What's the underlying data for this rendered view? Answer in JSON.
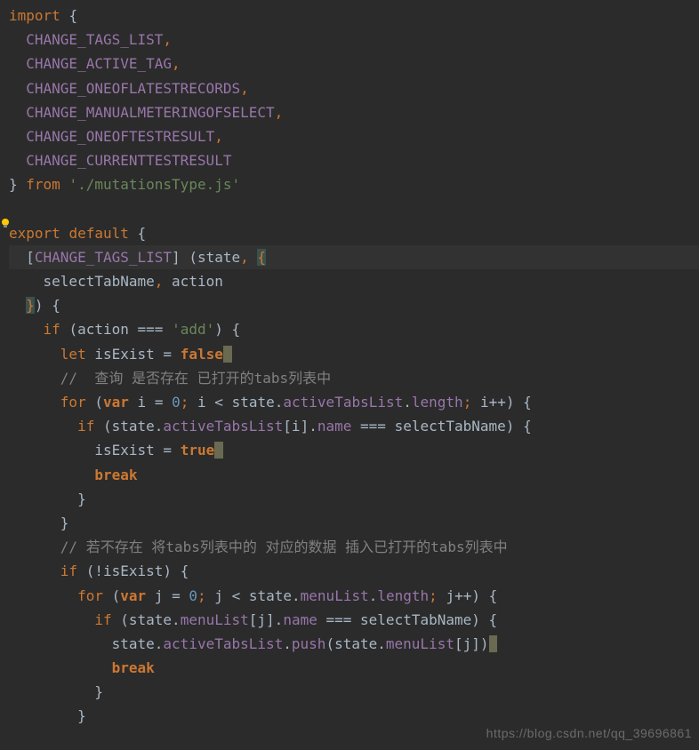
{
  "code": {
    "line1_import": "import",
    "line1_brace": "{",
    "line2": "CHANGE_TAGS_LIST",
    "line3": "CHANGE_ACTIVE_TAG",
    "line4": "CHANGE_ONEOFLATESTRECORDS",
    "line5": "CHANGE_MANUALMETERINGOFSELECT",
    "line6": "CHANGE_ONEOFTESTRESULT",
    "line7": "CHANGE_CURRENTTESTRESULT",
    "line8_from": "from",
    "line8_str": "'./mutationsType.js'",
    "line10_export": "export",
    "line10_default": "default",
    "line11_change": "CHANGE_TAGS_LIST",
    "line11_state": "state",
    "line12_select": "selectTabName",
    "line12_action": "action",
    "line14_if": "if",
    "line14_action": "action",
    "line14_str": "'add'",
    "line15_let": "let",
    "line15_isExist": "isExist",
    "line15_false": "false",
    "line16_comment": "//  查询 是否存在 已打开的tabs列表中",
    "line17_for": "for",
    "line17_var": "var",
    "line17_i": "i",
    "line17_zero": "0",
    "line17_state": "state",
    "line17_active": "activeTabsList",
    "line17_length": "length",
    "line18_if": "if",
    "line18_state": "state",
    "line18_active": "activeTabsList",
    "line18_i": "i",
    "line18_name": "name",
    "line18_select": "selectTabName",
    "line19_isExist": "isExist",
    "line19_true": "true",
    "line20_break": "break",
    "line23_comment": "// 若不存在 将tabs列表中的 对应的数据 插入已打开的tabs列表中",
    "line24_if": "if",
    "line24_isExist": "isExist",
    "line25_for": "for",
    "line25_var": "var",
    "line25_j": "j",
    "line25_zero": "0",
    "line25_state": "state",
    "line25_menu": "menuList",
    "line25_length": "length",
    "line26_if": "if",
    "line26_state": "state",
    "line26_menu": "menuList",
    "line26_j": "j",
    "line26_name": "name",
    "line26_select": "selectTabName",
    "line27_state": "state",
    "line27_active": "activeTabsList",
    "line27_push": "push",
    "line27_state2": "state",
    "line27_menu": "menuList",
    "line27_j": "j",
    "line28_break": "break",
    "comma": ",",
    "semicolon": ";",
    "eq3": "===",
    "eq": "=",
    "lt": "<",
    "pp": "++",
    "excl": "!",
    "dot": ".",
    "lbrack": "[",
    "rbrack": "]",
    "lparen": "(",
    "rparen": ")",
    "lbrace": "{",
    "rbrace": "}"
  },
  "watermark": "https://blog.csdn.net/qq_39696861"
}
